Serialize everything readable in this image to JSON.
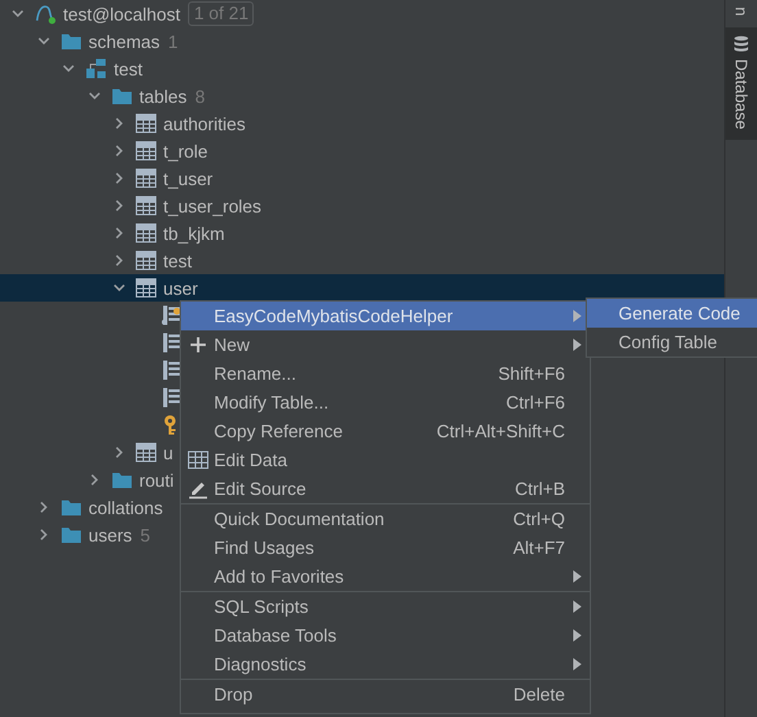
{
  "tree": [
    {
      "label": "test@localhost",
      "badge": "1 of 21",
      "kind": "datasource",
      "expanded": true,
      "selected": false,
      "children": [
        {
          "label": "schemas",
          "count": "1",
          "kind": "folder",
          "expanded": true,
          "selected": false,
          "children": [
            {
              "label": "test",
              "kind": "schema",
              "expanded": true,
              "selected": false,
              "children": [
                {
                  "label": "tables",
                  "count": "8",
                  "kind": "folder",
                  "expanded": true,
                  "selected": false,
                  "children": [
                    {
                      "label": "authorities",
                      "kind": "table",
                      "expanded": false,
                      "selected": false
                    },
                    {
                      "label": "t_role",
                      "kind": "table",
                      "expanded": false,
                      "selected": false
                    },
                    {
                      "label": "t_user",
                      "kind": "table",
                      "expanded": false,
                      "selected": false
                    },
                    {
                      "label": "t_user_roles",
                      "kind": "table",
                      "expanded": false,
                      "selected": false
                    },
                    {
                      "label": "tb_kjkm",
                      "kind": "table",
                      "expanded": false,
                      "selected": false
                    },
                    {
                      "label": "test",
                      "kind": "table",
                      "expanded": false,
                      "selected": false
                    },
                    {
                      "label": "user",
                      "kind": "table",
                      "expanded": true,
                      "selected": true,
                      "children": [
                        {
                          "kind": "primary_column",
                          "selected": false
                        },
                        {
                          "kind": "column",
                          "selected": false
                        },
                        {
                          "kind": "column",
                          "selected": false
                        },
                        {
                          "kind": "column",
                          "selected": false
                        },
                        {
                          "kind": "key",
                          "selected": false
                        }
                      ]
                    },
                    {
                      "label": "u",
                      "kind": "table",
                      "expanded": false,
                      "selected": false
                    }
                  ]
                },
                {
                  "label": "routi",
                  "kind": "folder",
                  "expanded": false,
                  "selected": false
                }
              ]
            }
          ]
        },
        {
          "label": "collations",
          "kind": "folder",
          "expanded": false,
          "selected": false
        },
        {
          "label": "users",
          "count": "5",
          "kind": "folder",
          "expanded": false,
          "selected": false
        }
      ]
    }
  ],
  "side_tabs": [
    {
      "label": "n",
      "selected": false,
      "kind": "cut"
    },
    {
      "label": "Database",
      "selected": true,
      "kind": "database"
    }
  ],
  "context_menu": {
    "groups": [
      [
        {
          "label": "EasyCodeMybatisCodeHelper",
          "kind": "plain",
          "submenu": true,
          "selected": true
        },
        {
          "label": "New",
          "kind": "add",
          "submenu": true,
          "selected": false
        },
        {
          "label": "Rename...",
          "shortcut": "Shift+F6",
          "kind": "plain",
          "submenu": false,
          "selected": false
        },
        {
          "label": "Modify Table...",
          "shortcut": "Ctrl+F6",
          "kind": "plain",
          "submenu": false,
          "selected": false
        },
        {
          "label": "Copy Reference",
          "shortcut": "Ctrl+Alt+Shift+C",
          "kind": "plain",
          "submenu": false,
          "selected": false
        },
        {
          "label": "Edit Data",
          "kind": "data",
          "submenu": false,
          "selected": false
        },
        {
          "label": "Edit Source",
          "shortcut": "Ctrl+B",
          "kind": "source",
          "submenu": false,
          "selected": false
        }
      ],
      [
        {
          "label": "Quick Documentation",
          "shortcut": "Ctrl+Q",
          "kind": "plain",
          "submenu": false,
          "selected": false
        },
        {
          "label": "Find Usages",
          "shortcut": "Alt+F7",
          "kind": "plain",
          "submenu": false,
          "selected": false
        },
        {
          "label": "Add to Favorites",
          "kind": "plain",
          "submenu": true,
          "selected": false
        }
      ],
      [
        {
          "label": "SQL Scripts",
          "kind": "plain",
          "submenu": true,
          "selected": false
        },
        {
          "label": "Database Tools",
          "kind": "plain",
          "submenu": true,
          "selected": false
        },
        {
          "label": "Diagnostics",
          "kind": "plain",
          "submenu": true,
          "selected": false
        }
      ],
      [
        {
          "label": "Drop",
          "shortcut": "Delete",
          "kind": "plain",
          "submenu": false,
          "selected": false
        }
      ]
    ]
  },
  "submenu": {
    "items": [
      {
        "label": "Generate Code",
        "selected": true
      },
      {
        "label": "Config Table",
        "selected": false
      }
    ]
  }
}
